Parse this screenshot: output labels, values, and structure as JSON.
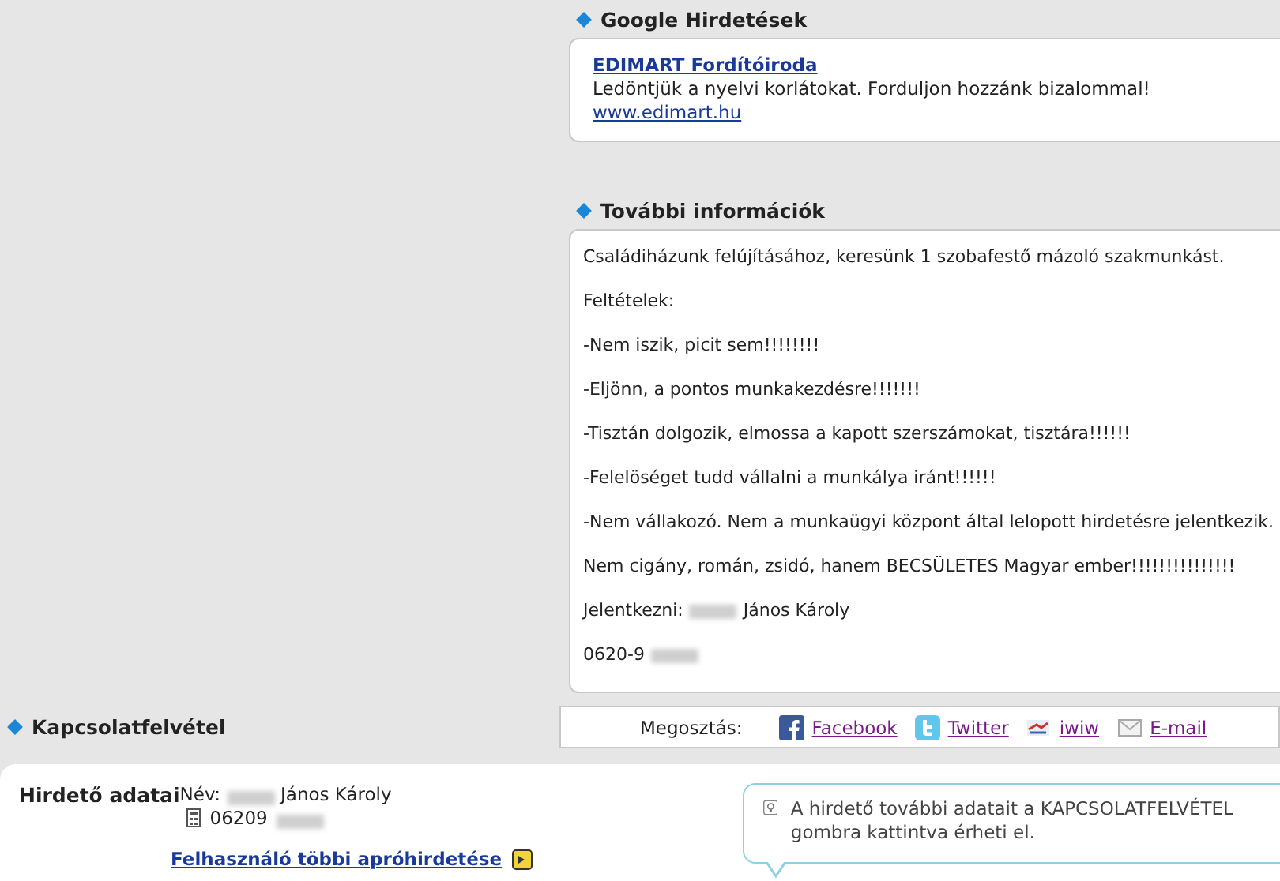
{
  "ads": {
    "title": "Google Hirdetések",
    "items": [
      {
        "headline": "EDIMART Fordítóiroda",
        "text": "Ledöntjük a nyelvi korlátokat. Forduljon hozzánk bizalommal!",
        "url": "www.edimart.hu"
      }
    ]
  },
  "info": {
    "title": "További információk",
    "lines": [
      {
        "kind": "text",
        "text": "Családiházunk felújításához, keresünk 1 szobafestő mázoló szakmunkást."
      },
      {
        "kind": "text",
        "text": "Feltételek:"
      },
      {
        "kind": "text",
        "text": "-Nem iszik, picit sem!!!!!!!!"
      },
      {
        "kind": "text",
        "text": "-Eljönn, a pontos munkakezdésre!!!!!!!"
      },
      {
        "kind": "text",
        "text": "-Tisztán dolgozik, elmossa a kapott szerszámokat, tisztára!!!!!!"
      },
      {
        "kind": "text",
        "text": "-Felelöséget tudd vállalni a munkálya iránt!!!!!!"
      },
      {
        "kind": "text",
        "text": "-Nem vállakozó. Nem a munkaügyi központ által lelopott hirdetésre jelentkezik."
      },
      {
        "kind": "text",
        "text": "Nem cigány, román, zsidó, hanem BECSÜLETES Magyar ember!!!!!!!!!!!!!!!"
      },
      {
        "kind": "redacted",
        "before": "Jelentkezni:",
        "after": "János Károly"
      },
      {
        "kind": "redacted",
        "before": "0620-9"
      }
    ]
  },
  "share": {
    "label": "Megosztás:",
    "links": [
      {
        "kind": "facebook",
        "label": "Facebook"
      },
      {
        "kind": "twitter",
        "label": "Twitter"
      },
      {
        "kind": "iwiw",
        "label": "iwiw"
      },
      {
        "kind": "email",
        "label": "E-mail"
      }
    ]
  },
  "contact": {
    "title": "Kapcsolatfelvétel",
    "heading": "Hirdető adatai",
    "name_label": "Név:",
    "name_after": "János Károly",
    "phone_before": "06209",
    "more_link": "Felhasználó többi apróhirdetése",
    "tip": "A hirdető további adatait a KAPCSOLATFELVÉTEL gombra kattintva érheti el."
  }
}
